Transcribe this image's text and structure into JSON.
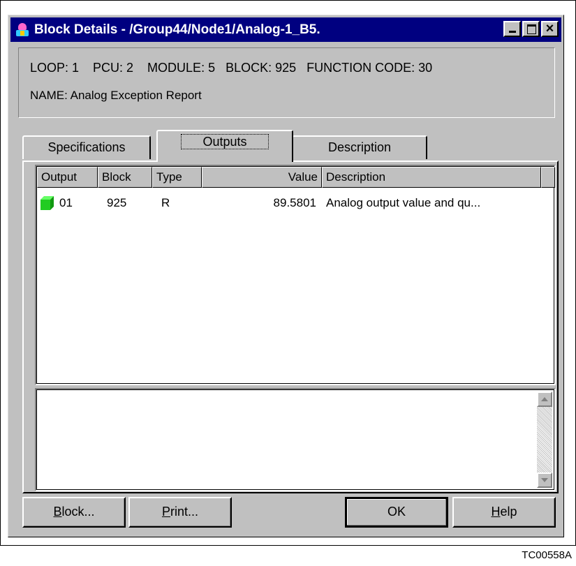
{
  "window": {
    "title": "Block Details - /Group44/Node1/Analog-1_B5.",
    "title_icon": "block-details-app-icon"
  },
  "info": {
    "line1": "LOOP: 1    PCU: 2    MODULE: 5   BLOCK: 925   FUNCTION CODE: 30",
    "name": "NAME: Analog Exception Report"
  },
  "tabs": [
    {
      "label": "Specifications",
      "active": false
    },
    {
      "label": "Outputs",
      "active": true
    },
    {
      "label": "Description",
      "active": false
    }
  ],
  "table": {
    "columns": [
      "Output",
      "Block",
      "Type",
      "Value",
      "Description"
    ],
    "rows": [
      {
        "icon": "green-cube-icon",
        "output": "01",
        "block": "925",
        "type": "R",
        "value": "89.5801",
        "description": "Analog output value and qu..."
      }
    ]
  },
  "buttons": {
    "block": {
      "prefix": "",
      "mnemonic": "B",
      "rest": "lock..."
    },
    "print": {
      "prefix": "",
      "mnemonic": "P",
      "rest": "rint..."
    },
    "ok": "OK",
    "help": {
      "prefix": "",
      "mnemonic": "H",
      "rest": "elp"
    }
  },
  "figure_code": "TC00558A",
  "colors": {
    "titlebar": "#000080",
    "face": "#c0c0c0",
    "output_icon": "#22cc22"
  }
}
